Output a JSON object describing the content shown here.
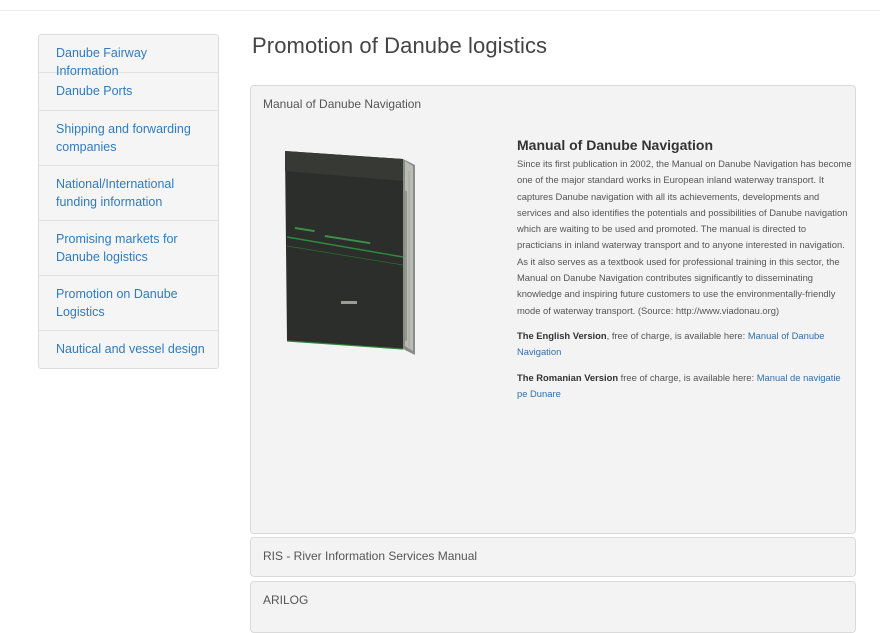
{
  "sidebar": {
    "items": [
      {
        "label": "Danube Fairway Information"
      },
      {
        "label": "Danube Ports"
      },
      {
        "label": "Shipping and forwarding companies"
      },
      {
        "label": "National/International funding information"
      },
      {
        "label": "Promising markets for Danube logistics"
      },
      {
        "label": "Promotion on Danube Logistics"
      },
      {
        "label": "Nautical and vessel design"
      }
    ]
  },
  "main": {
    "title": "Promotion of Danube logistics",
    "panels": [
      {
        "heading": "Manual of Danube Navigation",
        "article_title": "Manual of Danube Navigation",
        "body": "Since its first publication in 2002, the Manual on Danube Navigation has become one of the major standard works in European inland waterway transport. It captures Danube navigation with all its achievements, developments and services and also identifies the potentials and possibilities of Danube navigation which are waiting to be used and promoted. The manual is directed to practicians in inland waterway transport and to anyone interested in navigation. As it also serves as a textbook used for professional training in this sector, the Manual on Danube Navigation contributes significantly to disseminating knowledge and inspiring future customers to use the environmentally-friendly mode of waterway transport. (Source: http://www.viadonau.org)",
        "english_label": "The English Version",
        "english_text": ", free of charge, is available here: ",
        "english_link": "Manual of Danube Navigation",
        "romanian_label": "The Romanian Version",
        "romanian_text": " free of charge, is available here: ",
        "romanian_link": "Manual de navigatie pe Dunare"
      },
      {
        "heading": "RIS - River Information Services Manual"
      },
      {
        "heading": "ARILOG"
      }
    ]
  },
  "colors": {
    "link": "#2f7bbf",
    "panel_bg": "#f3f3f3",
    "book_cover": "#2b2e2a",
    "book_accent": "#2f8a3e"
  }
}
